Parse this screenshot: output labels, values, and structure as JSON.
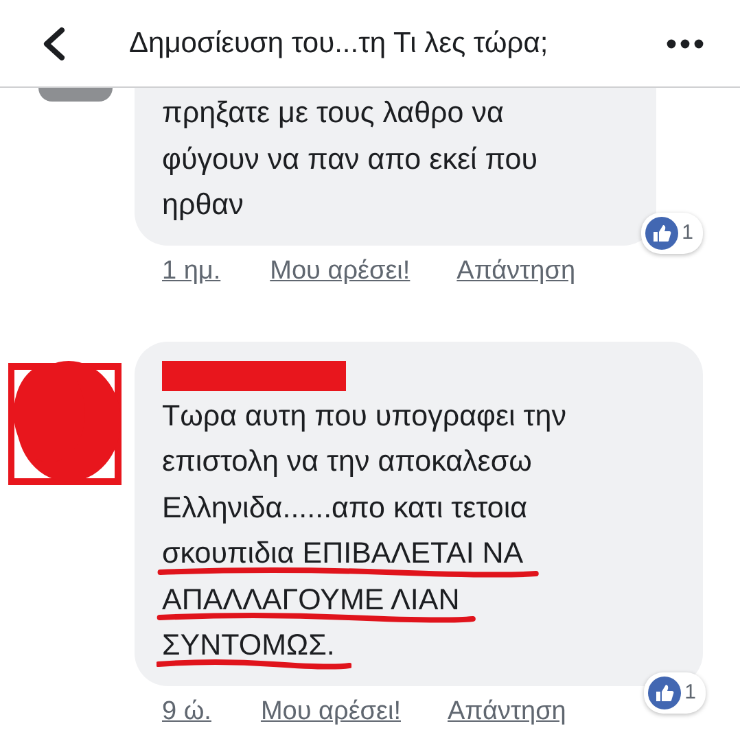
{
  "header": {
    "title": "Δημοσίευση του...τη Τι λες τώρα;"
  },
  "comments": [
    {
      "cut_top": true,
      "redacted": false,
      "lines": [
        {
          "text": "πρηξατε με τους λαθρο να",
          "marked": false
        },
        {
          "text": "φύγουν να παν απο εκεί που",
          "marked": false
        },
        {
          "text": "ηρθαν",
          "marked": false
        }
      ],
      "time": "1 ημ.",
      "like": "Μου αρέσει!",
      "reply": "Απάντηση",
      "reactions": "1"
    },
    {
      "cut_top": false,
      "redacted": true,
      "lines": [
        {
          "text": "Τωρα αυτη που υπογραφει την",
          "marked": false
        },
        {
          "text": "επιστολη να την αποκαλεσω",
          "marked": false
        },
        {
          "text": "Ελληνιδα......απο κατι τετοια",
          "marked": false
        },
        {
          "text": "σκουπιδια ΕΠΙΒΑΛΕΤΑΙ ΝΑ",
          "marked": true
        },
        {
          "text": "ΑΠΑΛΛΑΓΟΥΜΕ ΛΙΑΝ",
          "marked": true
        },
        {
          "text": "ΣΥΝΤΟΜΩΣ.",
          "marked": true
        }
      ],
      "time": "9 ώ.",
      "like": "Μου αρέσει!",
      "reply": "Απάντηση",
      "reactions": "1"
    }
  ]
}
